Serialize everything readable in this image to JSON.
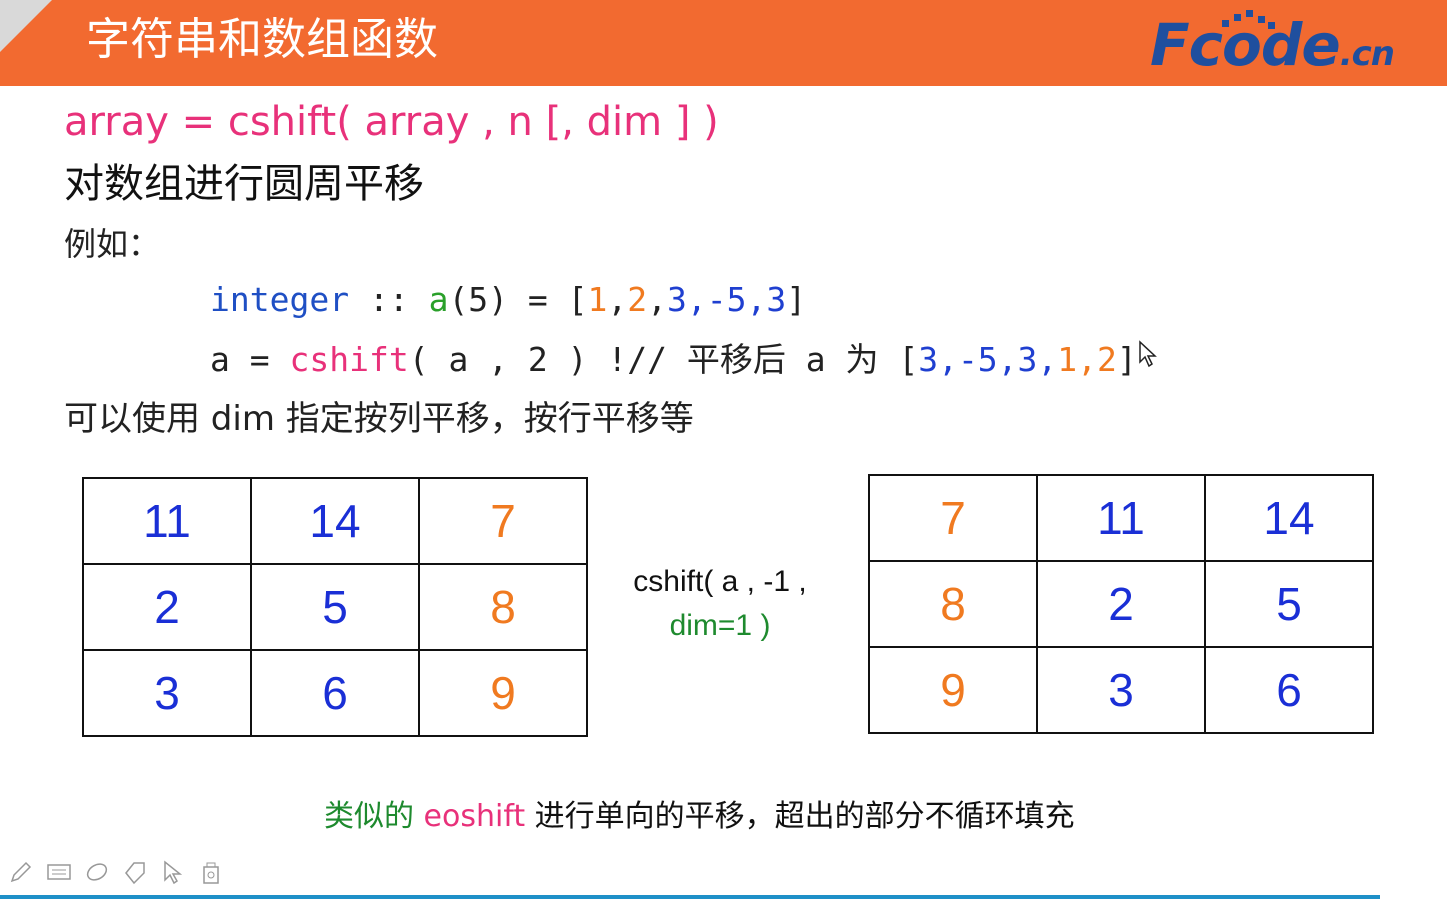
{
  "header": {
    "title": "字符串和数组函数",
    "logo": {
      "main": "Fcode",
      "suffix": ".cn"
    }
  },
  "syntax": "array = cshift( array , n [, dim ] )",
  "subtitle": "对数组进行圆周平移",
  "example_label": "例如：",
  "code": {
    "line1": {
      "keyword": "integer",
      "sep": " :: ",
      "var": "a",
      "decl": "(5) = [",
      "values": [
        {
          "text": "1",
          "color": "orange"
        },
        {
          "text": ",",
          "color": "none"
        },
        {
          "text": "2",
          "color": "orange"
        },
        {
          "text": ",",
          "color": "none"
        },
        {
          "text": "3",
          "color": "blue"
        },
        {
          "text": ",-5,",
          "color": "blue"
        },
        {
          "text": "3",
          "color": "blue"
        }
      ],
      "close": "]"
    },
    "line2": {
      "lhs": "a = ",
      "func": "cshift",
      "args": "( a , 2 ) !// 平移后 a 为 [",
      "values": [
        {
          "text": "3,-5,3,",
          "color": "blue"
        },
        {
          "text": "1,2",
          "color": "orange"
        }
      ],
      "close": "]"
    }
  },
  "note": "可以使用 dim 指定按列平移，按行平移等",
  "left_grid": [
    [
      {
        "v": "11",
        "c": "blue"
      },
      {
        "v": "14",
        "c": "blue"
      },
      {
        "v": "7",
        "c": "orange"
      }
    ],
    [
      {
        "v": "2",
        "c": "blue"
      },
      {
        "v": "5",
        "c": "blue"
      },
      {
        "v": "8",
        "c": "orange"
      }
    ],
    [
      {
        "v": "3",
        "c": "blue"
      },
      {
        "v": "6",
        "c": "blue"
      },
      {
        "v": "9",
        "c": "orange"
      }
    ]
  ],
  "operation": {
    "line1": "cshift( a , -1 ,",
    "line2": "dim=1 )"
  },
  "right_grid": [
    [
      {
        "v": "7",
        "c": "orange"
      },
      {
        "v": "11",
        "c": "blue"
      },
      {
        "v": "14",
        "c": "blue"
      }
    ],
    [
      {
        "v": "8",
        "c": "orange"
      },
      {
        "v": "2",
        "c": "blue"
      },
      {
        "v": "5",
        "c": "blue"
      }
    ],
    [
      {
        "v": "9",
        "c": "orange"
      },
      {
        "v": "3",
        "c": "blue"
      },
      {
        "v": "6",
        "c": "blue"
      }
    ]
  ],
  "bottom_note": {
    "prefix": "类似的 ",
    "func": "eoshift",
    "rest": " 进行单向的平移，超出的部分不循环填充"
  },
  "toolbar": {
    "icons": [
      "pen-icon",
      "keyboard-icon",
      "eraser-icon",
      "tag-icon",
      "pointer-icon",
      "camera-icon"
    ]
  },
  "colors": {
    "header_bg": "#f26a30",
    "syntax": "#e8317a",
    "blue": "#1a2fd6",
    "orange": "#f07a20",
    "green": "#1e8a2e"
  }
}
